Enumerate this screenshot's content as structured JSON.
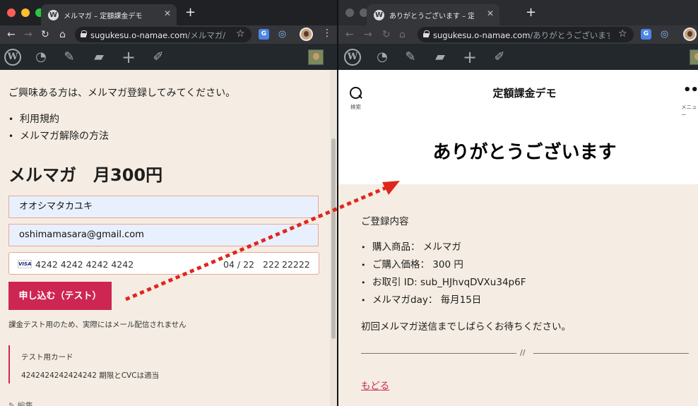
{
  "left_window": {
    "tab_title": "メルマガ – 定額課金デモ",
    "url_host": "sugukesu.o-namae.com",
    "url_path": "/メルマガ/",
    "intro": "ご興味ある方は、メルマガ登録してみてください。",
    "links": [
      "利用規約",
      "メルマガ解除の方法"
    ],
    "product_heading": "メルマガ　月300円",
    "form": {
      "name_value": "オオシマタカユキ",
      "email_value": "oshimamasara@gmail.com",
      "card_brand": "VISA",
      "card_number": "4242 4242 4242 4242",
      "card_expiry": "04 / 22",
      "card_cvc": "222",
      "card_zip": "22222",
      "submit_label": "申し込む（テスト）"
    },
    "notice": "課金テスト用のため、実際にはメール配信されません",
    "test_card": {
      "title": "テスト用カード",
      "body": "4242424242424242 期限とCVCは適当"
    },
    "edit_label": "編集"
  },
  "right_window": {
    "tab_title": "ありがとうございます – 定額課金デモ",
    "url_host": "sugukesu.o-namae.com",
    "url_path": "/ありがとうございます...",
    "site_title": "定額課金デモ",
    "search_label": "検索",
    "menu_label": "メニュー",
    "page_title": "ありがとうございます",
    "registration_heading": "ご登録内容",
    "details": [
      "購入商品： メルマガ",
      "ご購入価格： 300 円",
      "お取引 ID: sub_HJhvqDVXu34p6F",
      "メルマガday： 毎月15日"
    ],
    "wait_message": "初回メルマガ送信までしばらくお待ちください。",
    "separator_mark": "//",
    "back_link": "もどる"
  },
  "colors": {
    "accent": "#cd2653",
    "page_bg": "#f5ede3",
    "arrow": "#e0261c",
    "admin_bar": "#23282d"
  }
}
